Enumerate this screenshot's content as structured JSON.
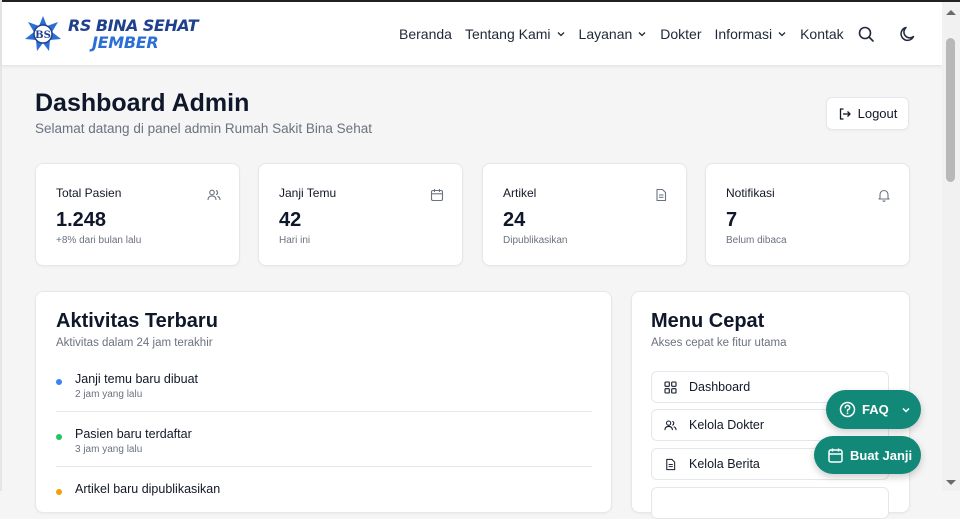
{
  "brand": {
    "line1": "RS BINA SEHAT",
    "line2": "JEMBER",
    "emblem_text": "BS"
  },
  "nav": {
    "items": [
      {
        "label": "Beranda",
        "dropdown": false
      },
      {
        "label": "Tentang Kami",
        "dropdown": true
      },
      {
        "label": "Layanan",
        "dropdown": true
      },
      {
        "label": "Dokter",
        "dropdown": false
      },
      {
        "label": "Informasi",
        "dropdown": true
      },
      {
        "label": "Kontak",
        "dropdown": false
      }
    ],
    "icons": [
      "search-icon",
      "moon-icon"
    ]
  },
  "page": {
    "title": "Dashboard Admin",
    "subtitle": "Selamat datang di panel admin Rumah Sakit Bina Sehat",
    "logout_label": "Logout"
  },
  "stats": [
    {
      "label": "Total Pasien",
      "value": "1.248",
      "sub": "+8% dari bulan lalu",
      "icon": "users-icon"
    },
    {
      "label": "Janji Temu",
      "value": "42",
      "sub": "Hari ini",
      "icon": "calendar-icon"
    },
    {
      "label": "Artikel",
      "value": "24",
      "sub": "Dipublikasikan",
      "icon": "document-icon"
    },
    {
      "label": "Notifikasi",
      "value": "7",
      "sub": "Belum dibaca",
      "icon": "bell-icon"
    }
  ],
  "activity": {
    "title": "Aktivitas Terbaru",
    "desc": "Aktivitas dalam 24 jam terakhir",
    "items": [
      {
        "text": "Janji temu baru dibuat",
        "time": "2 jam yang lalu",
        "color": "#3b82f6"
      },
      {
        "text": "Pasien baru terdaftar",
        "time": "3 jam yang lalu",
        "color": "#22c55e"
      },
      {
        "text": "Artikel baru dipublikasikan",
        "time": "",
        "color": "#f59e0b"
      }
    ]
  },
  "quick_menu": {
    "title": "Menu Cepat",
    "desc": "Akses cepat ke fitur utama",
    "items": [
      {
        "label": "Dashboard",
        "icon": "grid-icon"
      },
      {
        "label": "Kelola Dokter",
        "icon": "users-icon"
      },
      {
        "label": "Kelola Berita",
        "icon": "document-icon"
      }
    ]
  },
  "floating": {
    "faq_label": "FAQ",
    "appointment_label": "Buat Janji"
  },
  "colors": {
    "accent": "#128978",
    "brand_dark": "#1f3f8f",
    "brand_light": "#2b6fd6",
    "background": "#f5f5f6"
  }
}
